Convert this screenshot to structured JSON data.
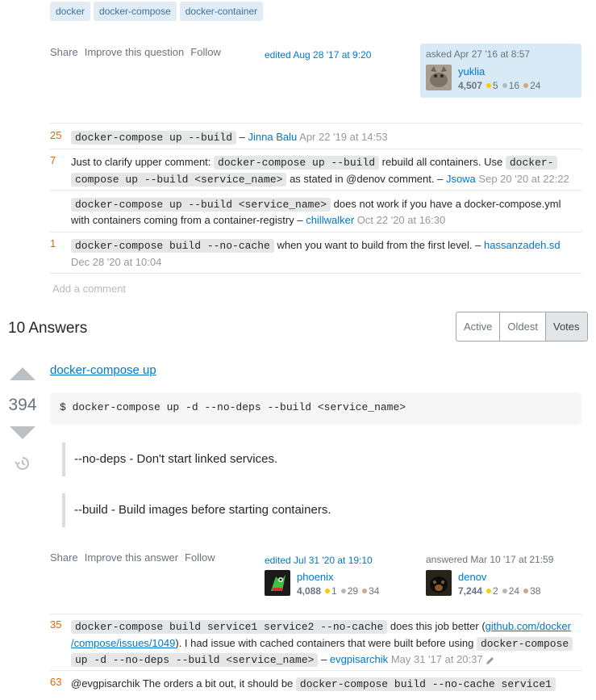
{
  "tags": [
    "docker",
    "docker-compose",
    "docker-container"
  ],
  "question_menu": {
    "share": "Share",
    "improve": "Improve this question",
    "follow": "Follow"
  },
  "question_edited": "edited Aug 28 '17 at 9:20",
  "question_asker": {
    "when": "asked Apr 27 '16 at 8:57",
    "name": "yuklia",
    "rep": "4,507",
    "gold": "5",
    "silver": "16",
    "bronze": "24"
  },
  "question_comments": [
    {
      "score": "25",
      "code1": "docker-compose up --build",
      "dash": "–",
      "author": "Jinna Balu",
      "date": "Apr 22 '19 at 14:53"
    },
    {
      "score": "7",
      "pre": "Just to clarify upper comment: ",
      "code1": "docker-compose up --build",
      "mid": " rebuild all containers. Use ",
      "code2a": "docker-",
      "code2b": "compose up --build <service_name>",
      "post": " as stated in @denov comment. –",
      "author": "Jsowa",
      "date": "Sep 20 '20 at 22:22"
    },
    {
      "score": "",
      "code1": "docker-compose up --build <service_name>",
      "text1": " does not work if you have a docker-compose.yml",
      "text2": "with containers coming from a container-registry –",
      "author": "chillwalker",
      "date": "Oct 22 '20 at 16:30"
    },
    {
      "score": "1",
      "code1": "docker-compose build --no-cache",
      "text1": " when you want to build from the first level. –",
      "author": "hassanzadeh.sd",
      "date": "Dec 28 '20 at 10:04"
    }
  ],
  "add_comment": "Add a comment",
  "answers": {
    "count": "10",
    "label": "Answers"
  },
  "sort_tabs": [
    "Active",
    "Oldest",
    "Votes"
  ],
  "answer": {
    "votes": "394",
    "title": "docker-compose up",
    "code": "$ docker-compose up -d --no-deps --build <service_name>",
    "quote1": "--no-deps - Don't start linked services.",
    "quote2": "--build - Build images before starting containers.",
    "menu": {
      "share": "Share",
      "improve": "Improve this answer",
      "follow": "Follow"
    },
    "editor": {
      "when": "edited Jul 31 '20 at 19:10",
      "name": "phoenix",
      "rep": "4,088",
      "gold": "1",
      "silver": "29",
      "bronze": "34"
    },
    "author": {
      "when": "answered Mar 10 '17 at 21:59",
      "name": "denov",
      "rep": "7,244",
      "gold": "2",
      "silver": "24",
      "bronze": "38"
    }
  },
  "answer_comments": [
    {
      "score": "35",
      "code1": "docker-compose build service1 service2 --no-cache",
      "t1": " does this job better (",
      "link1": "github.com/docker",
      "link2": "/compose/issues/1049",
      "t2": "). I had issue with cached containers that were built before using ",
      "code2a": "docker-compose",
      "code2b": "up -d --no-deps --build <service_name>",
      "dash": " –",
      "author": "evgpisarchik",
      "date": "May 31 '17 at 20:37"
    },
    {
      "score": "63",
      "text": "@evgpisarchik The orders a bit out, it should be ",
      "code1": "docker-compose build --no-cache service1"
    }
  ]
}
